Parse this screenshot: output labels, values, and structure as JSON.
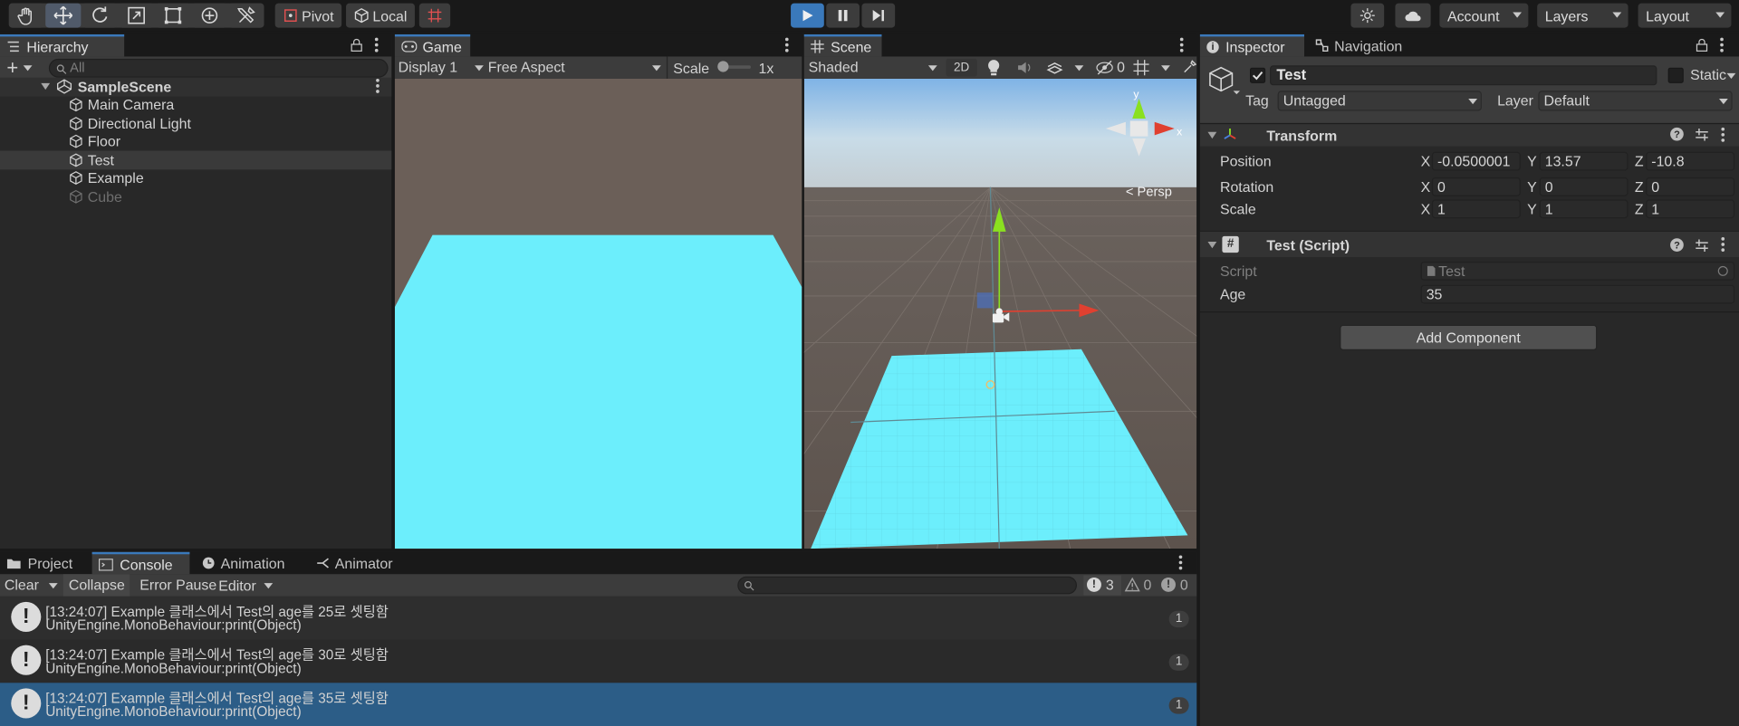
{
  "toolbar": {
    "pivot": "Pivot",
    "local": "Local",
    "account": "Account",
    "layers": "Layers",
    "layout": "Layout"
  },
  "hierarchy": {
    "tab": "Hierarchy",
    "search_placeholder": "All",
    "scene": "SampleScene",
    "items": [
      {
        "label": "Main Camera",
        "disabled": false
      },
      {
        "label": "Directional Light",
        "disabled": false
      },
      {
        "label": "Floor",
        "disabled": false
      },
      {
        "label": "Test",
        "disabled": false,
        "selected": true
      },
      {
        "label": "Example",
        "disabled": false
      },
      {
        "label": "Cube",
        "disabled": true
      }
    ]
  },
  "game": {
    "tab": "Game",
    "display": "Display 1",
    "aspect": "Free Aspect",
    "scale_label": "Scale",
    "scale_value": "1x"
  },
  "scene_view": {
    "tab": "Scene",
    "shading": "Shaded",
    "mode_2d": "2D",
    "hidden_count": "0",
    "gizmo_y": "y",
    "gizmo_x": "x",
    "persp": "Persp"
  },
  "inspector": {
    "tab": "Inspector",
    "nav_tab": "Navigation",
    "object_name": "Test",
    "static_label": "Static",
    "tag_label": "Tag",
    "tag_value": "Untagged",
    "layer_label": "Layer",
    "layer_value": "Default",
    "transform": {
      "title": "Transform",
      "position_label": "Position",
      "rotation_label": "Rotation",
      "scale_label": "Scale",
      "axis_x": "X",
      "axis_y": "Y",
      "axis_z": "Z",
      "position": {
        "x": "-0.0500001",
        "y": "13.57",
        "z": "-10.8"
      },
      "rotation": {
        "x": "0",
        "y": "0",
        "z": "0"
      },
      "scale": {
        "x": "1",
        "y": "1",
        "z": "1"
      }
    },
    "script_component": {
      "title": "Test (Script)",
      "script_label": "Script",
      "script_value": "Test",
      "age_label": "Age",
      "age_value": "35"
    },
    "add_component": "Add Component"
  },
  "bottom": {
    "tabs": {
      "project": "Project",
      "console": "Console",
      "animation": "Animation",
      "animator": "Animator"
    },
    "clear": "Clear",
    "collapse": "Collapse",
    "error_pause": "Error Pause",
    "editor": "Editor",
    "count_errors": "3",
    "count_warnings": "0",
    "count_messages": "0",
    "logs": [
      {
        "line1": "[13:24:07] Example 클래스에서 Test의 age를 25로 셋팅함",
        "line2": "UnityEngine.MonoBehaviour:print(Object)",
        "count": "1"
      },
      {
        "line1": "[13:24:07] Example 클래스에서 Test의 age를 30로 셋팅함",
        "line2": "UnityEngine.MonoBehaviour:print(Object)",
        "count": "1"
      },
      {
        "line1": "[13:24:07] Example 클래스에서 Test의 age를 35로 셋팅함",
        "line2": "UnityEngine.MonoBehaviour:print(Object)",
        "count": "1"
      }
    ]
  },
  "colors": {
    "selection": "#2c5d87",
    "floor": "#6eeefc",
    "play_active": "#3a79bb"
  }
}
